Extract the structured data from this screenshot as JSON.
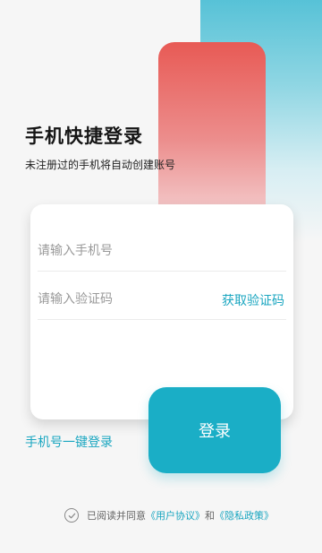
{
  "header": {
    "title": "手机快捷登录",
    "subtitle": "未注册过的手机将自动创建账号"
  },
  "form": {
    "phone_placeholder": "请输入手机号",
    "code_placeholder": "请输入验证码",
    "get_code_label": "获取验证码",
    "login_label": "登录"
  },
  "one_key_login_label": "手机号一键登录",
  "agreement": {
    "prefix": "已阅读并同意",
    "user_agreement": "《用户协议》",
    "conjunction": "和",
    "privacy_policy": "《隐私政策》",
    "check_icon": "check-circle-icon"
  },
  "colors": {
    "accent": "#1aaec6",
    "decor_red": "#e85a55",
    "decor_teal": "#57c2d7"
  }
}
